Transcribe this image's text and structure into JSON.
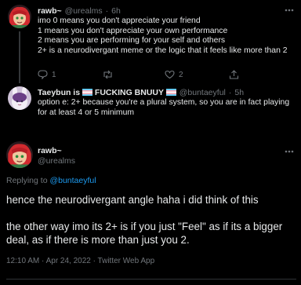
{
  "tweets": [
    {
      "display_name": "rawb~",
      "handle": "@urealms",
      "time": "6h",
      "body": "imo 0 means you don't appreciate your friend\n1 means you don't appreciate your own performance\n2 means you are performing for your self and others\n2+ is a neurodivergant meme or the logic that it feels like more than 2",
      "replies": "1",
      "retweets": "",
      "likes": "2"
    },
    {
      "display_name_prefix": "Taeybun is ",
      "display_name_suffix": "FUCKING BNUUY",
      "handle": "@buntaeyful",
      "time": "5h",
      "body": "option e: 2+ because you're a plural system, so you are in fact playing for at least 4 or 5 minimum",
      "replies": "",
      "retweets": "",
      "likes": "",
      "colors": {
        "flag_blue": "#5bcefa",
        "flag_pink": "#f5a9b8",
        "flag_white": "#ffffff"
      }
    }
  ],
  "main_tweet": {
    "display_name": "rawb~",
    "handle": "@urealms",
    "replying_to_label": "Replying to",
    "replying_to_handle": "@buntaeyful",
    "body": "hence the neurodivergant angle haha i did think of this\n\nthe other way imo its 2+ is if you just \"Feel\" as if its a bigger deal, as if there is more than just you 2.",
    "timestamp": "12:10 AM · Apr 24, 2022 · Twitter Web App"
  },
  "icons": {
    "reply": "speech-bubble-icon",
    "retweet": "retweet-arrows-icon",
    "like": "heart-icon",
    "share": "share-upload-icon"
  },
  "colors": {
    "background": "#000000",
    "text": "#e7e9ea",
    "muted": "#71767b",
    "link": "#1d9bf0",
    "thread_line": "#333639"
  }
}
